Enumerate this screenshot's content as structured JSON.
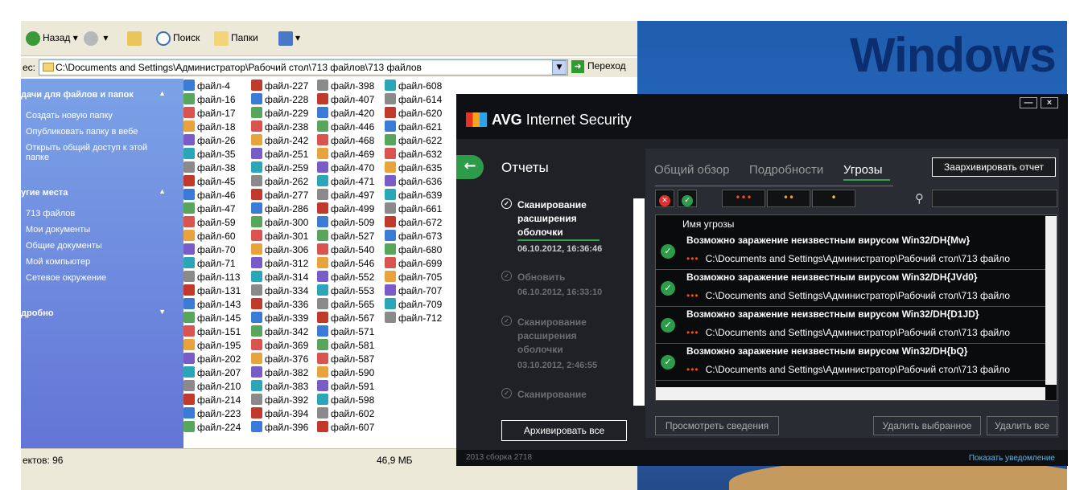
{
  "desktop": {
    "logo_text": "Windows"
  },
  "explorer": {
    "toolbar": {
      "back": "Назад",
      "search": "Поиск",
      "folders": "Папки"
    },
    "address": {
      "label": "ес:",
      "path": "C:\\Documents and Settings\\Администратор\\Рабочий стол\\713 файлов\\713 файлов",
      "go": "Переход"
    },
    "tasks": {
      "section1": "дачи для файлов и папок",
      "links1": [
        "Создать новую папку",
        "Опубликовать папку в вебе",
        "Открыть общий доступ к этой папке"
      ],
      "section2": "угие места",
      "links2": [
        "713 файлов",
        "Мои документы",
        "Общие документы",
        "Мой компьютер",
        "Сетевое окружение"
      ],
      "section3": "дробно"
    },
    "files": [
      [
        "файл-4",
        "файл-16",
        "файл-17",
        "файл-18",
        "файл-26",
        "файл-35",
        "файл-38",
        "файл-45",
        "файл-46",
        "файл-47",
        "файл-59",
        "файл-60",
        "файл-70",
        "файл-71",
        "файл-113",
        "файл-131",
        "файл-143",
        "файл-145",
        "файл-151",
        "файл-195",
        "файл-202",
        "файл-207",
        "файл-210",
        "файл-214",
        "файл-223",
        "файл-224"
      ],
      [
        "файл-227",
        "файл-228",
        "файл-229",
        "файл-238",
        "файл-242",
        "файл-251",
        "файл-259",
        "файл-262",
        "файл-277",
        "файл-286",
        "файл-300",
        "файл-301",
        "файл-306",
        "файл-312",
        "файл-314",
        "файл-334",
        "файл-336",
        "файл-339",
        "файл-342",
        "файл-369",
        "файл-376",
        "файл-382",
        "файл-383",
        "файл-392",
        "файл-394",
        "файл-396"
      ],
      [
        "файл-398",
        "файл-407",
        "файл-420",
        "файл-446",
        "файл-468",
        "файл-469",
        "файл-470",
        "файл-471",
        "файл-497",
        "файл-499",
        "файл-509",
        "файл-527",
        "файл-540",
        "файл-546",
        "файл-552",
        "файл-553",
        "файл-565",
        "файл-567",
        "файл-571",
        "файл-581",
        "файл-587",
        "файл-590",
        "файл-591",
        "файл-598",
        "файл-602",
        "файл-607"
      ],
      [
        "файл-608",
        "файл-614",
        "файл-620",
        "файл-621",
        "файл-622",
        "файл-632",
        "файл-635",
        "файл-636",
        "файл-639",
        "файл-661",
        "файл-672",
        "файл-673",
        "файл-680",
        "файл-699",
        "файл-705",
        "файл-707",
        "файл-709",
        "файл-712"
      ]
    ],
    "status": {
      "objects": "ектов: 96",
      "size": "46,9 МБ"
    }
  },
  "avg": {
    "logo_bold": "AVG",
    "logo_rest": "Internet Security",
    "win_minimize": "—",
    "win_close": "×",
    "back_glyph": "←",
    "reports_title": "Отчеты",
    "reports": [
      {
        "title": "Сканирование расширения оболочки",
        "date": "06.10.2012, 16:36:46",
        "active": true
      },
      {
        "title": "Обновить",
        "date": "06.10.2012, 16:33:10",
        "active": false
      },
      {
        "title": "Сканирование расширения оболочки",
        "date": "03.10.2012, 2:46:55",
        "active": false
      },
      {
        "title": "Сканирование",
        "date": "",
        "active": false
      }
    ],
    "archive_all": "Архивировать все",
    "tabs": [
      "Общий обзор",
      "Подробности",
      "Угрозы"
    ],
    "archive_report": "Заархивировать отчет",
    "column_header": "Имя угрозы",
    "threats": [
      {
        "name": "Возможно заражение неизвестным вирусом Win32/DH{Mw}",
        "path": "C:\\Documents and Settings\\Администратор\\Рабочий стол\\713 файло"
      },
      {
        "name": "Возможно заражение неизвестным вирусом Win32/DH{JVd0}",
        "path": "C:\\Documents and Settings\\Администратор\\Рабочий стол\\713 файло"
      },
      {
        "name": "Возможно заражение неизвестным вирусом Win32/DH{D1JD}",
        "path": "C:\\Documents and Settings\\Администратор\\Рабочий стол\\713 файло"
      },
      {
        "name": "Возможно заражение неизвестным вирусом Win32/DH{bQ}",
        "path": "C:\\Documents and Settings\\Администратор\\Рабочий стол\\713 файло"
      }
    ],
    "btn_details": "Просмотреть сведения",
    "btn_delete_selected": "Удалить выбранное",
    "btn_delete_all": "Удалить все",
    "build": "2013  сборка 2718",
    "notify": "Показать уведомление",
    "severity_dots": "•••",
    "colors": {
      "accent": "#2ea24f",
      "dots": "#f34b1b",
      "bg": "#1f2126"
    }
  }
}
